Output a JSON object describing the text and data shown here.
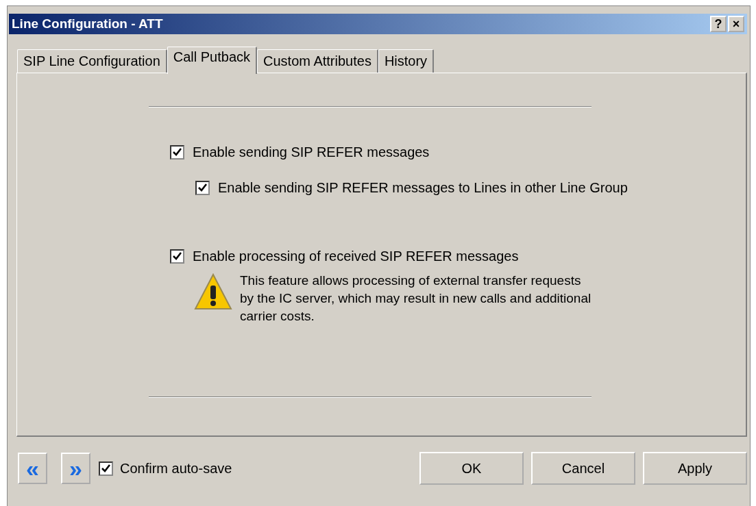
{
  "window": {
    "title": "Line Configuration - ATT",
    "title_buttons": [
      "?",
      "×"
    ]
  },
  "tabs": [
    {
      "label": "SIP Line Configuration",
      "selected": false
    },
    {
      "label": "Call Putback",
      "selected": true
    },
    {
      "label": "Custom Attributes",
      "selected": false
    },
    {
      "label": "History",
      "selected": false
    }
  ],
  "options": [
    {
      "label": "Enable sending SIP REFER messages",
      "checked": true,
      "children": [
        {
          "label": "Enable sending SIP REFER messages to Lines in other Line Group",
          "checked": true
        }
      ]
    },
    {
      "label": "Enable processing of received SIP REFER messages",
      "checked": true
    }
  ],
  "warning": "This feature allows processing of external transfer requests by the IC server, which may result in new calls and additional carrier costs.",
  "footer": {
    "nav_buttons": [
      "«",
      "»"
    ],
    "confirm": {
      "label": "Confirm auto-save",
      "checked": true
    },
    "buttons": [
      "OK",
      "Cancel",
      "Apply"
    ]
  }
}
